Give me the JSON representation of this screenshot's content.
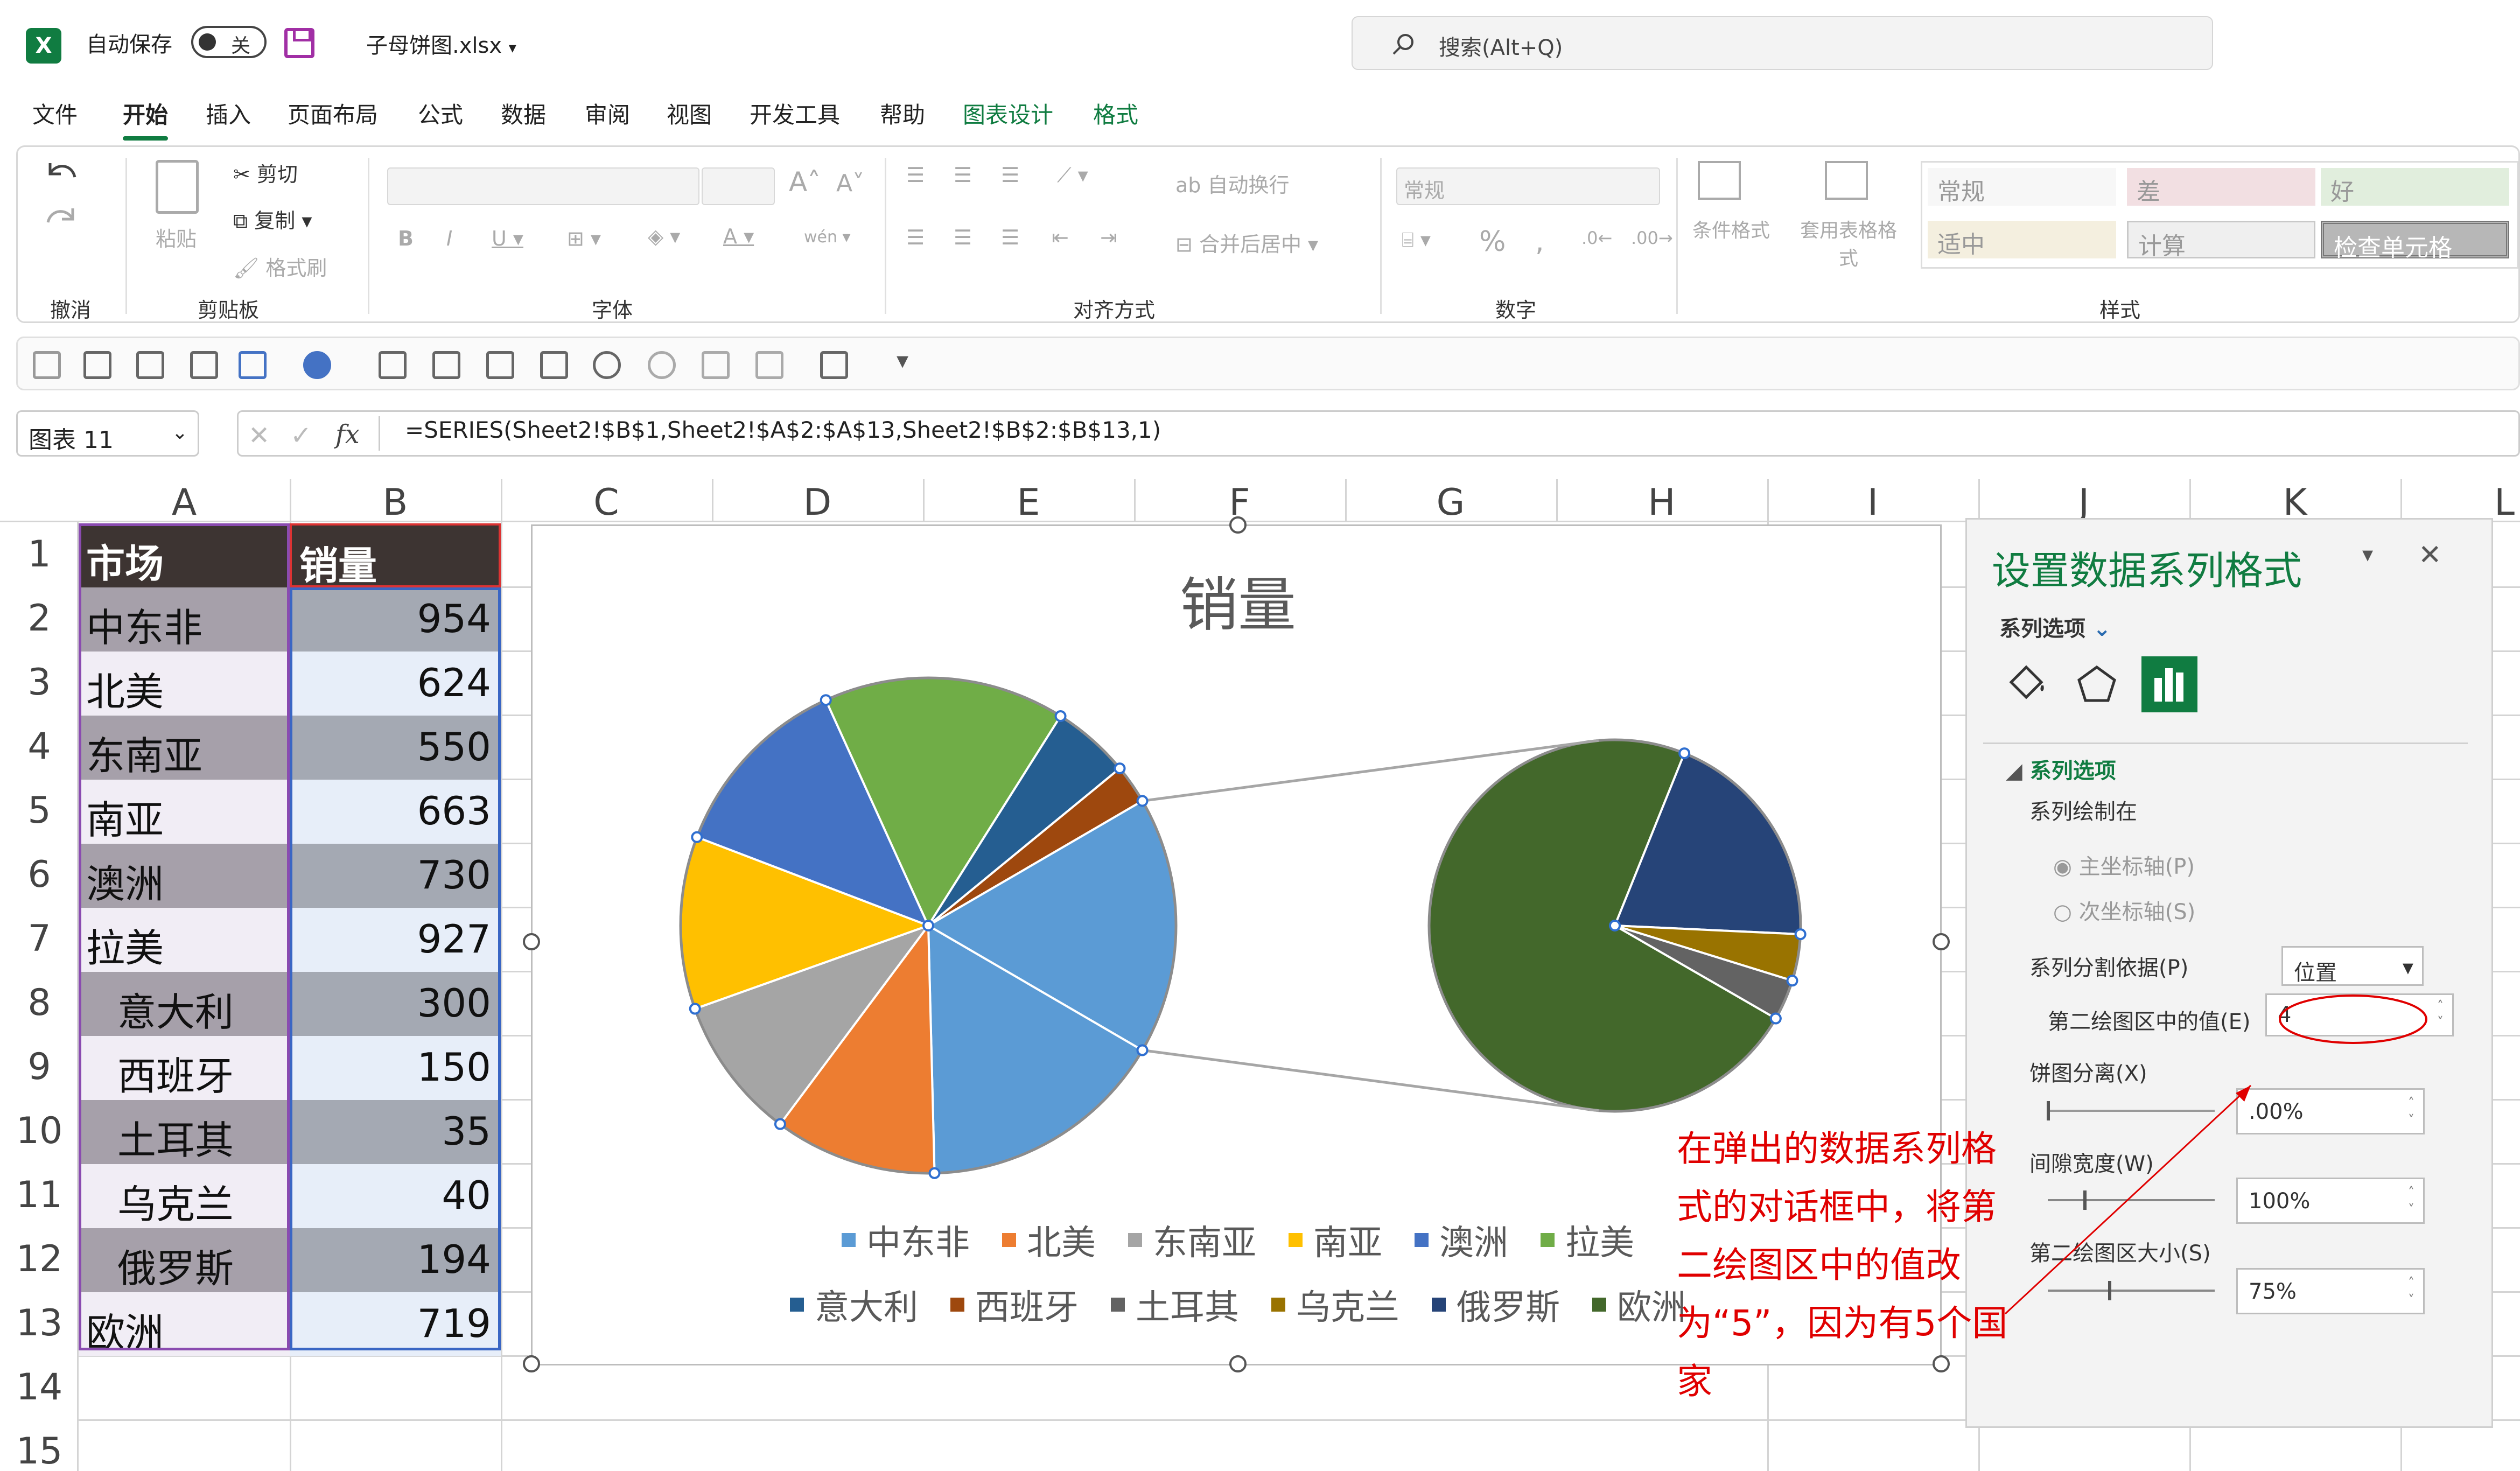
{
  "titlebar": {
    "autosave_label": "自动保存",
    "autosave_state": "关",
    "filename": "子母饼图.xlsx",
    "search_placeholder": "搜索(Alt+Q)"
  },
  "menu_tabs": [
    "文件",
    "开始",
    "插入",
    "页面布局",
    "公式",
    "数据",
    "审阅",
    "视图",
    "开发工具",
    "帮助",
    "图表设计",
    "格式"
  ],
  "ribbon": {
    "undo_group": "撤消",
    "clipboard": {
      "paste": "粘贴",
      "cut": "剪切",
      "copy": "复制",
      "format_painter": "格式刷",
      "label": "剪贴板"
    },
    "font_group": "字体",
    "align": {
      "wrap": "自动换行",
      "merge": "合并后居中",
      "label": "对齐方式"
    },
    "number": {
      "format": "常规",
      "label": "数字"
    },
    "styles": {
      "conditional": "条件格式",
      "table": "套用表格格式",
      "cells": [
        "常规",
        "差",
        "好",
        "适中",
        "计算",
        "检查单元格"
      ],
      "label": "样式"
    }
  },
  "formula_bar": {
    "name_box": "图表 11",
    "formula": "=SERIES(Sheet2!$B$1,Sheet2!$A$2:$A$13,Sheet2!$B$2:$B$13,1)"
  },
  "columns": [
    "A",
    "B",
    "C",
    "D",
    "E",
    "F",
    "G",
    "H",
    "I",
    "J",
    "K",
    "L"
  ],
  "rows": [
    "1",
    "2",
    "3",
    "4",
    "5",
    "6",
    "7",
    "8",
    "9",
    "10",
    "11",
    "12",
    "13",
    "14",
    "15"
  ],
  "table": {
    "header": [
      "市场",
      "销量"
    ],
    "rows": [
      {
        "market": "中东非",
        "sales": "954"
      },
      {
        "market": "北美",
        "sales": "624"
      },
      {
        "market": "东南亚",
        "sales": "550"
      },
      {
        "market": "南亚",
        "sales": "663"
      },
      {
        "market": "澳洲",
        "sales": "730"
      },
      {
        "market": "拉美",
        "sales": "927"
      },
      {
        "market": "意大利",
        "sales": "300"
      },
      {
        "market": "西班牙",
        "sales": "150"
      },
      {
        "market": "土耳其",
        "sales": "35"
      },
      {
        "market": "乌克兰",
        "sales": "40"
      },
      {
        "market": "俄罗斯",
        "sales": "194"
      },
      {
        "market": "欧洲",
        "sales": "719"
      }
    ]
  },
  "chart_data": {
    "type": "pie",
    "subtype": "pie-of-pie",
    "title": "销量",
    "categories": [
      "中东非",
      "北美",
      "东南亚",
      "南亚",
      "澳洲",
      "拉美",
      "意大利",
      "西班牙",
      "土耳其",
      "乌克兰",
      "俄罗斯",
      "欧洲"
    ],
    "values": [
      954,
      624,
      550,
      663,
      730,
      927,
      300,
      150,
      35,
      40,
      194,
      719
    ],
    "colors": [
      "#5b9bd5",
      "#ed7d31",
      "#a5a5a5",
      "#ffc000",
      "#4472c4",
      "#70ad47",
      "#255e91",
      "#9e480e",
      "#636363",
      "#997300",
      "#264478",
      "#43682b"
    ],
    "second_plot_values": 4,
    "legend_position": "bottom"
  },
  "format_pane": {
    "title": "设置数据系列格式",
    "subtitle": "系列选项",
    "section": "系列选项",
    "plot_on": "系列绘制在",
    "primary_axis": "主坐标轴(P)",
    "secondary_axis": "次坐标轴(S)",
    "split_by_label": "系列分割依据(P)",
    "split_by_value": "位置",
    "second_plot_label": "第二绘图区中的值(E)",
    "second_plot_value": "4",
    "explosion_label": "饼图分离(X)",
    "explosion_value": ".00%",
    "gap_label": "间隙宽度(W)",
    "gap_value": "100%",
    "size_label": "第二绘图区大小(S)",
    "size_value": "75%"
  },
  "annotation": "在弹出的数据系列格式的对话框中，将第二绘图区中的值改为“5”，因为有5个国家"
}
